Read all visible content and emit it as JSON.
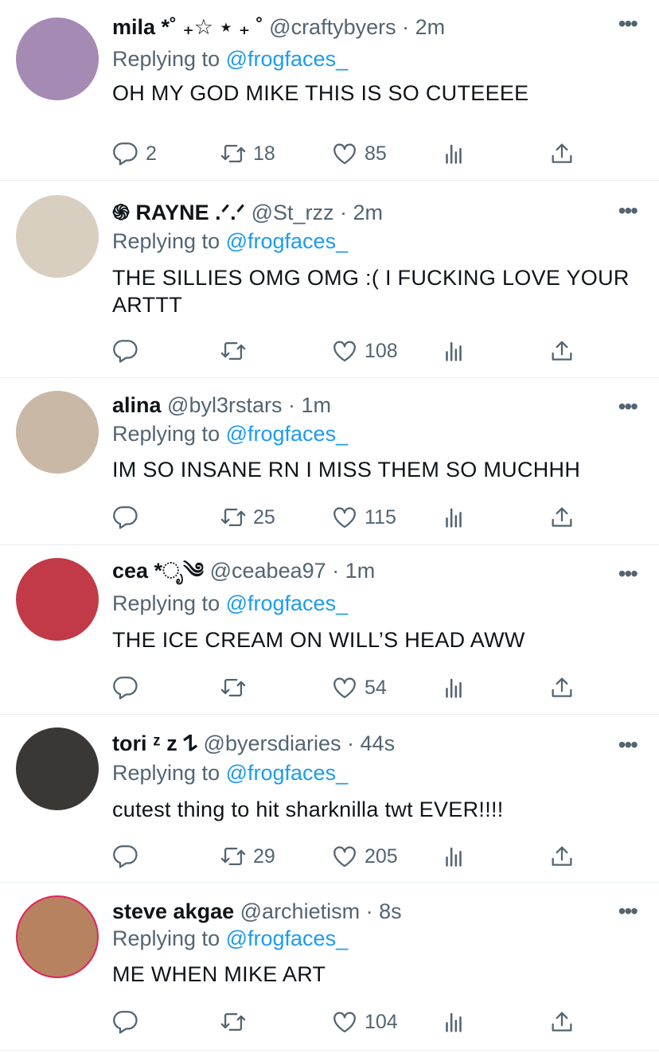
{
  "replies": [
    {
      "name": "mila *˚ ₊☆ ⋆ ₊ ˚",
      "handle": "@craftybyers",
      "sep": "·",
      "time": "2m",
      "replying_label": "Replying to",
      "replying_to": "@frogfaces_",
      "text": "OH MY GOD MIKE THIS IS SO CUTEEEE",
      "reply_count": "2",
      "retweet_count": "18",
      "like_count": "85",
      "more": "•••",
      "avatar_color": "#a58ab3"
    },
    {
      "name": "֍ RAYNE .ᐟ.ᐟ",
      "handle": "@St_rzz",
      "sep": "·",
      "time": "2m",
      "replying_label": "Replying to",
      "replying_to": "@frogfaces_",
      "text": "THE SILLIES OMG OMG :( I FUCKING LOVE YOUR ARTTT",
      "reply_count": "",
      "retweet_count": "",
      "like_count": "108",
      "more": "•••",
      "avatar_color": "#d9cfc0"
    },
    {
      "name": "alina",
      "handle": "@byl3rstars",
      "sep": "·",
      "time": "1m",
      "replying_label": "Replying to",
      "replying_to": "@frogfaces_",
      "text": "IM SO INSANE RN I MISS THEM SO MUCHHH",
      "reply_count": "",
      "retweet_count": "25",
      "like_count": "115",
      "more": "•••",
      "avatar_color": "#c9b8a6"
    },
    {
      "name": "cea *ೃ༄",
      "handle": "@ceabea97",
      "sep": "·",
      "time": "1m",
      "replying_label": "Replying to",
      "replying_to": "@frogfaces_",
      "text": "THE ICE CREAM ON WILL’S HEAD AWW",
      "reply_count": "",
      "retweet_count": "",
      "like_count": "54",
      "more": "•••",
      "avatar_color": "#c23a47"
    },
    {
      "name": "tori ᶻ z 𐰁",
      "handle": "@byersdiaries",
      "sep": "·",
      "time": "44s",
      "replying_label": "Replying to",
      "replying_to": "@frogfaces_",
      "text": "cutest thing to hit sharknilla twt EVER!!!!",
      "reply_count": "",
      "retweet_count": "29",
      "like_count": "205",
      "more": "•••",
      "avatar_color": "#3b3735"
    },
    {
      "name": "steve akgae",
      "handle": "@archietism",
      "sep": "·",
      "time": "8s",
      "replying_label": "Replying to",
      "replying_to": "@frogfaces_",
      "text": "ME WHEN MIKE ART",
      "reply_count": "",
      "retweet_count": "",
      "like_count": "104",
      "more": "•••",
      "avatar_color": "#b7825f"
    }
  ]
}
